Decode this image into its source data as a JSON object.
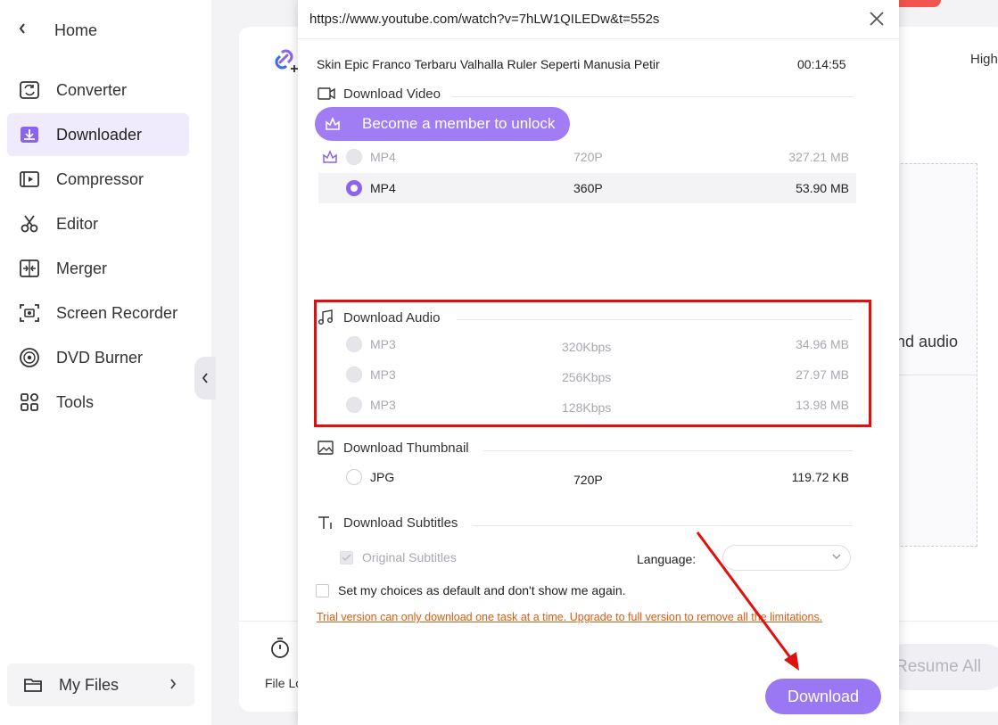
{
  "sidebar": {
    "home_label": "Home",
    "items": [
      {
        "label": "Converter",
        "icon": "converter-icon"
      },
      {
        "label": "Downloader",
        "icon": "downloader-icon",
        "active": true
      },
      {
        "label": "Compressor",
        "icon": "compressor-icon"
      },
      {
        "label": "Editor",
        "icon": "scissors-icon"
      },
      {
        "label": "Merger",
        "icon": "merger-icon"
      },
      {
        "label": "Screen Recorder",
        "icon": "screen-recorder-icon"
      },
      {
        "label": "DVD Burner",
        "icon": "dvd-icon"
      },
      {
        "label": "Tools",
        "icon": "tools-grid-icon"
      }
    ],
    "my_files_label": "My Files"
  },
  "background": {
    "high_label": "High",
    "audio_text": "nd audio",
    "file_location_label": "File Lo",
    "resume_all_label": "Resume All"
  },
  "dialog": {
    "url": "https://www.youtube.com/watch?v=7hLW1QILEDw&t=552s",
    "video_title": "Skin Epic Franco Terbaru Valhalla Ruler Seperti Manusia Petir",
    "duration": "00:14:55",
    "video_section": {
      "heading": "Download Video",
      "member_button": "Become a member to unlock",
      "options": [
        {
          "format": "MP4",
          "quality": "720P",
          "size": "327.21 MB",
          "locked": true
        },
        {
          "format": "MP4",
          "quality": "360P",
          "size": "53.90 MB",
          "selected": true
        }
      ]
    },
    "audio_section": {
      "heading": "Download Audio",
      "options": [
        {
          "format": "MP3",
          "quality": "320Kbps",
          "size": "34.96 MB"
        },
        {
          "format": "MP3",
          "quality": "256Kbps",
          "size": "27.97 MB"
        },
        {
          "format": "MP3",
          "quality": "128Kbps",
          "size": "13.98 MB"
        }
      ]
    },
    "thumbnail_section": {
      "heading": "Download Thumbnail",
      "options": [
        {
          "format": "JPG",
          "quality": "720P",
          "size": "119.72 KB"
        }
      ]
    },
    "subtitles_section": {
      "heading": "Download Subtitles",
      "original_label": "Original Subtitles",
      "language_label": "Language:",
      "language_value": ""
    },
    "default_choice_label": "Set my choices as default and don't show me again.",
    "trial_note": "Trial version can only download one task at a time.  Upgrade to full version to remove all the limitations.",
    "download_button": "Download"
  },
  "colors": {
    "accent": "#9a77f3",
    "highlight_box": "#e01010",
    "warning_text": "#e2590e",
    "annotation_arrow": "#e01010"
  }
}
